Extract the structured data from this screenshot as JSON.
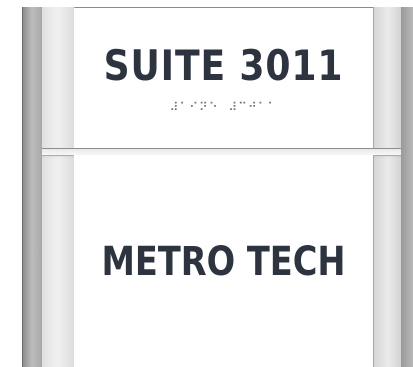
{
  "sign": {
    "room_label": "SUITE 3011",
    "braille": "⠼⠁⠊⠝⠑⠀⠼⠉⠚⠁⠁",
    "company_name": "METRO TECH"
  },
  "colors": {
    "text": "#2d3440",
    "braille": "#6f7480",
    "panel": "#ffffff",
    "frame": "#bdbdbd"
  }
}
